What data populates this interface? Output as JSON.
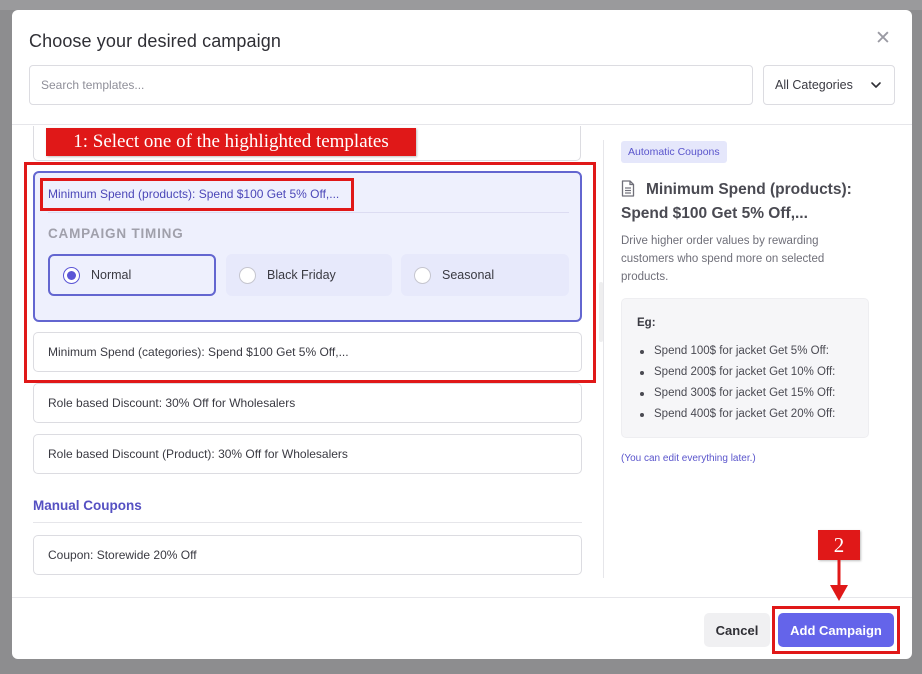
{
  "modal": {
    "title": "Choose your desired campaign",
    "close_glyph": "✕"
  },
  "search": {
    "placeholder": "Search templates...",
    "value": ""
  },
  "category_select": {
    "selected": "All Categories",
    "icon": "chevron-down-icon"
  },
  "templates": {
    "selected": {
      "title": "Minimum Spend (products): Spend $100 Get 5% Off,...",
      "timing_label": "CAMPAIGN TIMING",
      "timing_options": [
        {
          "label": "Normal",
          "selected": true
        },
        {
          "label": "Black Friday",
          "selected": false
        },
        {
          "label": "Seasonal",
          "selected": false
        }
      ]
    },
    "items": [
      {
        "label": "Minimum Spend (categories): Spend $100 Get 5% Off,..."
      },
      {
        "label": "Role based Discount: 30% Off for Wholesalers"
      },
      {
        "label": "Role based Discount (Product): 30% Off for Wholesalers"
      }
    ],
    "manual_heading": "Manual Coupons",
    "manual_items": [
      {
        "label": "Coupon: Storewide 20% Off"
      }
    ]
  },
  "preview": {
    "badge": "Automatic Coupons",
    "icon": "document-icon",
    "title": "Minimum Spend (products): Spend $100 Get 5% Off,...",
    "description": "Drive higher order values by rewarding customers who spend more on selected products.",
    "example_label": "Eg:",
    "examples": [
      "Spend 100$ for jacket Get 5% Off:",
      "Spend 200$ for jacket Get 10% Off:",
      "Spend 300$ for jacket Get 15% Off:",
      "Spend 400$ for jacket Get 20% Off:"
    ],
    "note": "(You can edit everything later.)"
  },
  "footer": {
    "cancel_label": "Cancel",
    "add_label": "Add Campaign"
  },
  "annotations": {
    "step1": "1: Select one of the highlighted templates",
    "step2": "2",
    "color": "#e01818"
  },
  "colors": {
    "accent": "#6464ea",
    "selected_border": "#6366d0",
    "selected_bg": "#eef0fd"
  }
}
